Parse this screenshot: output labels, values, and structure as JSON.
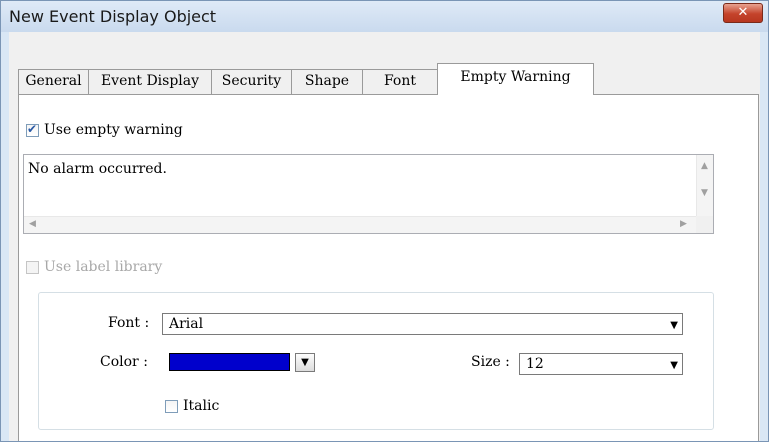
{
  "window": {
    "title": "New Event Display Object",
    "close_glyph": "✕"
  },
  "tabs": [
    {
      "label": "General"
    },
    {
      "label": "Event Display"
    },
    {
      "label": "Security"
    },
    {
      "label": "Shape"
    },
    {
      "label": "Font"
    },
    {
      "label": "Empty Warning",
      "active": true
    }
  ],
  "empty_warning": {
    "use_empty_warning_label": "Use empty warning",
    "use_empty_warning_checked": true,
    "message_text": "No alarm occurred.",
    "use_label_library_label": "Use label library",
    "use_label_library_enabled": false
  },
  "font_settings": {
    "font_label": "Font :",
    "font_value": "Arial",
    "color_label": "Color :",
    "color_value": "#0000cc",
    "size_label": "Size :",
    "size_value": "12",
    "italic_label": "Italic",
    "italic_checked": false
  },
  "icons": {
    "close": "close-icon",
    "dropdown": "chevron-down-icon",
    "checkbox_check": "check-icon"
  }
}
